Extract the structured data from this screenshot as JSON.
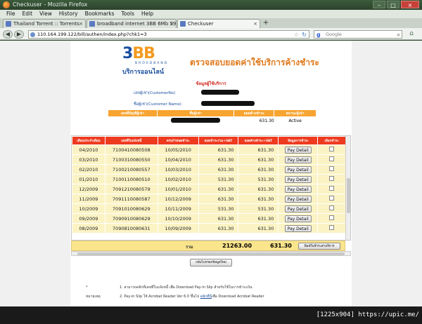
{
  "window": {
    "title": "Checkuser - Mozilla Firefox",
    "controls": {
      "minimize": "–",
      "maximize": "□",
      "close": "×"
    }
  },
  "menu": [
    "File",
    "Edit",
    "View",
    "History",
    "Bookmarks",
    "Tools",
    "Help"
  ],
  "tabs": [
    {
      "label": "Thailand Torrent :: Torrents",
      "active": false
    },
    {
      "label": "broadband internet 3BB 6Mb 590 บา...",
      "active": false
    },
    {
      "label": "Checkuser",
      "active": true
    }
  ],
  "nav": {
    "url": "110.164.199.122/bill/authen/index.php?chk1=3",
    "search_placeholder": "Google"
  },
  "page": {
    "logo_num": "3",
    "logo_bb": "BB",
    "logo_broadband": "BROADBAND",
    "logo_online": "บริการออนไลน์",
    "title": "ตรวจสอบยอดค่าใช้บริการค้างชำระ",
    "section_title": "ข้อมูลผู้ใช้บริการ",
    "customer_no_label": "เลขผู้เช่า(CustomerNo)",
    "customer_name_label": "ชื่อผู้เช่า(Customer Name)",
    "summary_headers": [
      "เลขที่บัญชีผู้เช่า",
      "ชื่อผู้เช่า",
      "ยอดค้างชำระ",
      "สถานะผู้เช่า"
    ],
    "summary_row": {
      "balance": "631.30",
      "status": "Active"
    },
    "table_headers": [
      "เดือนประจำเดือน",
      "เลขที่ใบแจ้งหนี้",
      "ครบกำหนดชำระ",
      "ยอดชำระรวม+VAT",
      "ยอดค้างชำระ+VAT",
      "ข้อมูลการชำระ",
      "เลือกชำระ"
    ],
    "rows": [
      {
        "month": "04/2010",
        "invoice": "7100410080508",
        "due": "10/05/2010",
        "total": "631.30",
        "outstanding": "631.30"
      },
      {
        "month": "03/2010",
        "invoice": "7100310080550",
        "due": "10/04/2010",
        "total": "631.30",
        "outstanding": "631.30"
      },
      {
        "month": "02/2010",
        "invoice": "7100210080557",
        "due": "10/03/2010",
        "total": "631.30",
        "outstanding": "631.30"
      },
      {
        "month": "01/2010",
        "invoice": "7100110080510",
        "due": "10/02/2010",
        "total": "531.30",
        "outstanding": "531.30"
      },
      {
        "month": "12/2009",
        "invoice": "7091210080579",
        "due": "10/01/2010",
        "total": "631.30",
        "outstanding": "631.30"
      },
      {
        "month": "11/2009",
        "invoice": "7091110080587",
        "due": "10/12/2009",
        "total": "631.30",
        "outstanding": "631.30"
      },
      {
        "month": "10/2009",
        "invoice": "7091010080629",
        "due": "10/11/2009",
        "total": "531.30",
        "outstanding": "531.30"
      },
      {
        "month": "09/2009",
        "invoice": "7090910080629",
        "due": "10/10/2009",
        "total": "631.30",
        "outstanding": "631.30"
      },
      {
        "month": "08/2009",
        "invoice": "7090810080631",
        "due": "10/09/2009",
        "total": "631.30",
        "outstanding": "631.30"
      }
    ],
    "pay_label": "Pay Detail",
    "total_label": "รวม",
    "total_amount": "21263.00",
    "total_selected": "631.30",
    "print_button": "พิมพ์ใบชำระค่าบริการ",
    "back_button": "กลับไปกรอกข้อมูลใหม่",
    "notes_label": "* หมายเหตุ",
    "note1": "1. สามารถคลิกที่เลขที่ใบแจ้งหนี้ เพื่อ Download Pay-in Slip สำหรับใช้ในการชำระเงิน",
    "note2_pre": "2. Pay-in Slip ใช้ Acrobat Reader Ver 6.0 ขึ้นไป",
    "note2_link": "คลิกที่นี่",
    "note2_post": "เพื่อ Download Acrobat Reader"
  },
  "watermark": "[1225x904] https://upic.me/"
}
